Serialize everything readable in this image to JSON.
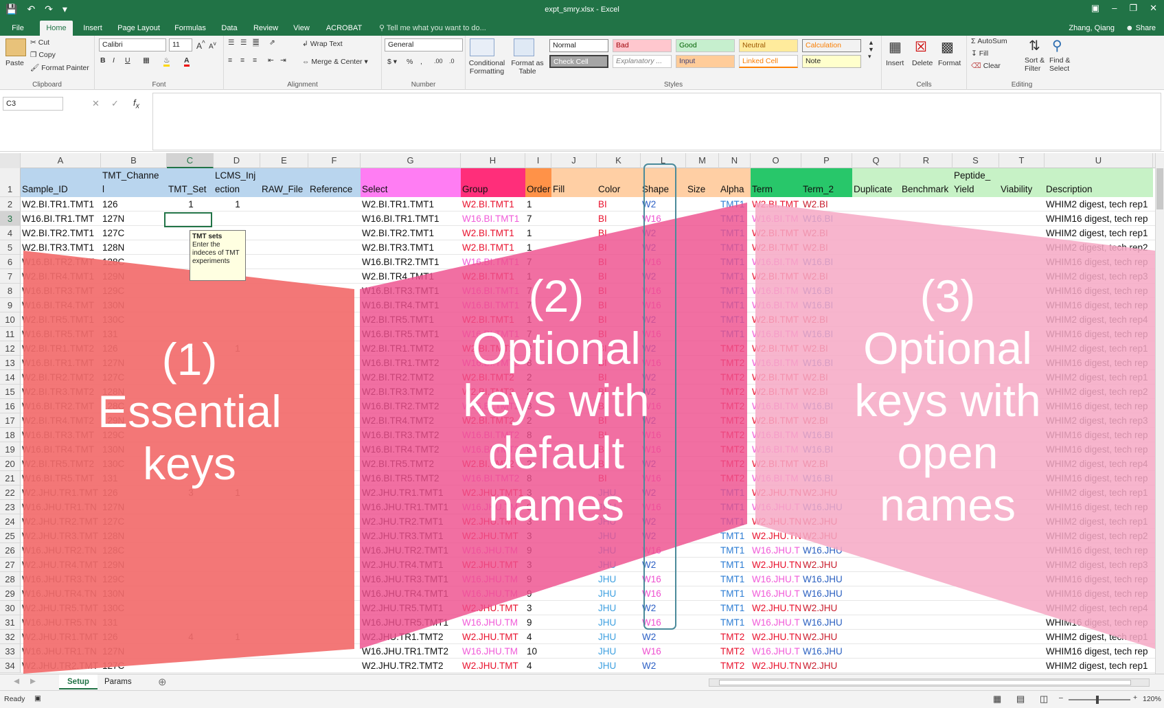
{
  "app": {
    "title": "expt_smry.xlsx - Excel",
    "user": "Zhang, Qiang",
    "share": "Share",
    "tell_me": "Tell me what you want to do..."
  },
  "tabs": [
    "File",
    "Home",
    "Insert",
    "Page Layout",
    "Formulas",
    "Data",
    "Review",
    "View",
    "ACROBAT"
  ],
  "ribbon": {
    "clipboard": {
      "label": "Clipboard",
      "paste": "Paste",
      "cut": "Cut",
      "copy": "Copy",
      "painter": "Format Painter"
    },
    "font": {
      "label": "Font",
      "name": "Calibri",
      "size": "11"
    },
    "alignment": {
      "label": "Alignment",
      "wrap": "Wrap Text",
      "merge": "Merge & Center"
    },
    "number": {
      "label": "Number",
      "format": "General"
    },
    "styles": {
      "label": "Styles",
      "cond": "Conditional Formatting",
      "table": "Format as Table",
      "normal": "Normal",
      "bad": "Bad",
      "good": "Good",
      "neutral": "Neutral",
      "calculation": "Calculation",
      "check": "Check Cell",
      "explanatory": "Explanatory ...",
      "input": "Input",
      "linked": "Linked Cell",
      "note": "Note"
    },
    "cells": {
      "label": "Cells",
      "insert": "Insert",
      "delete": "Delete",
      "format": "Format"
    },
    "editing": {
      "label": "Editing",
      "autosum": "AutoSum",
      "fill": "Fill",
      "clear": "Clear",
      "sort": "Sort & Filter",
      "find": "Find & Select"
    }
  },
  "namebox": "C3",
  "columns": [
    "A",
    "B",
    "C",
    "D",
    "E",
    "F",
    "G",
    "H",
    "I",
    "J",
    "K",
    "L",
    "M",
    "N",
    "O",
    "P",
    "Q",
    "R",
    "S",
    "T",
    "U"
  ],
  "header_top": {
    "B": "TMT_Channe",
    "D": "LCMS_Inj",
    "S": "Peptide_"
  },
  "header_bottom": {
    "A": "Sample_ID",
    "B": "l",
    "C": "TMT_Set",
    "D": "ection",
    "E": "RAW_File",
    "F": "Reference",
    "G": "Select",
    "H": "Group",
    "I": "Order",
    "J": "Fill",
    "K": "Color",
    "L": "Shape",
    "M": "Size",
    "N": "Alpha",
    "O": "Term",
    "P": "Term_2",
    "Q": "Duplicate",
    "R": "Benchmark",
    "S": "Yield",
    "T": "Viability",
    "U": "Description"
  },
  "rows": [
    {
      "n": "2",
      "A": "W2.BI.TR1.TMT1",
      "B": "126",
      "C": "1",
      "D": "1",
      "G": "W2.BI.TR1.TMT1",
      "H": "W2.BI.TMT1",
      "I": "1",
      "K": "BI",
      "L": "W2",
      "N": "TMT1",
      "O": "W2.BI.TMT",
      "P": "W2.BI",
      "U": "WHIM2 digest, tech rep1"
    },
    {
      "n": "3",
      "A": "W16.BI.TR1.TMT",
      "B": "127N",
      "G": "W16.BI.TR1.TMT1",
      "H": "W16.BI.TMT1",
      "I": "7",
      "K": "BI",
      "L": "W16",
      "N": "TMT1",
      "O": "W16.BI.TM",
      "P": "W16.BI",
      "U": "WHIM16 digest, tech rep"
    },
    {
      "n": "4",
      "A": "W2.BI.TR2.TMT1",
      "B": "127C",
      "G": "W2.BI.TR2.TMT1",
      "H": "W2.BI.TMT1",
      "I": "1",
      "K": "BI",
      "L": "W2",
      "N": "TMT1",
      "O": "W2.BI.TMT",
      "P": "W2.BI",
      "U": "WHIM2 digest, tech rep1"
    },
    {
      "n": "5",
      "A": "W2.BI.TR3.TMT1",
      "B": "128N",
      "G": "W2.BI.TR3.TMT1",
      "H": "W2.BI.TMT1",
      "I": "1",
      "K": "BI",
      "L": "W2",
      "N": "TMT1",
      "O": "W2.BI.TMT",
      "P": "W2.BI",
      "U": "WHIM2 digest, tech rep2"
    },
    {
      "n": "6",
      "A": "W16.BI.TR2.TMT",
      "B": "128C",
      "G": "W16.BI.TR2.TMT1",
      "H": "W16.BI.TMT1",
      "I": "7",
      "K": "BI",
      "L": "W16",
      "N": "TMT1",
      "O": "W16.BI.TM",
      "P": "W16.BI",
      "U": "WHIM16 digest, tech rep"
    },
    {
      "n": "7",
      "A": "W2.BI.TR4.TMT1",
      "B": "129N",
      "G": "W2.BI.TR4.TMT1",
      "H": "W2.BI.TMT1",
      "I": "1",
      "K": "BI",
      "L": "W2",
      "N": "TMT1",
      "O": "W2.BI.TMT",
      "P": "W2.BI",
      "U": "WHIM2 digest, tech rep3"
    },
    {
      "n": "8",
      "A": "W16.BI.TR3.TMT",
      "B": "129C",
      "G": "W16.BI.TR3.TMT1",
      "H": "W16.BI.TMT1",
      "I": "7",
      "K": "BI",
      "L": "W16",
      "N": "TMT1",
      "O": "W16.BI.TM",
      "P": "W16.BI",
      "U": "WHIM16 digest, tech rep"
    },
    {
      "n": "9",
      "A": "W16.BI.TR4.TMT",
      "B": "130N",
      "G": "W16.BI.TR4.TMT1",
      "H": "W16.BI.TMT1",
      "I": "7",
      "K": "BI",
      "L": "W16",
      "N": "TMT1",
      "O": "W16.BI.TM",
      "P": "W16.BI",
      "U": "WHIM16 digest, tech rep"
    },
    {
      "n": "10",
      "A": "W2.BI.TR5.TMT1",
      "B": "130C",
      "G": "W2.BI.TR5.TMT1",
      "H": "W2.BI.TMT1",
      "I": "1",
      "K": "BI",
      "L": "W2",
      "N": "TMT1",
      "O": "W2.BI.TMT",
      "P": "W2.BI",
      "U": "WHIM2 digest, tech rep4"
    },
    {
      "n": "11",
      "A": "W16.BI.TR5.TMT",
      "B": "131",
      "G": "W16.BI.TR5.TMT1",
      "H": "W16.BI.TMT1",
      "I": "7",
      "K": "BI",
      "L": "W16",
      "N": "TMT1",
      "O": "W16.BI.TM",
      "P": "W16.BI",
      "U": "WHIM16 digest, tech rep"
    },
    {
      "n": "12",
      "A": "W2.BI.TR1.TMT2",
      "B": "126",
      "C": "2",
      "D": "1",
      "G": "W2.BI.TR1.TMT2",
      "H": "W2.BI.TMT2",
      "I": "2",
      "K": "BI",
      "L": "W2",
      "N": "TMT2",
      "O": "W2.BI.TMT",
      "P": "W2.BI",
      "U": "WHIM2 digest, tech rep1"
    },
    {
      "n": "13",
      "A": "W16.BI.TR1.TMT",
      "B": "127N",
      "G": "W16.BI.TR1.TMT2",
      "H": "W16.BI.TMT2",
      "I": "8",
      "K": "BI",
      "L": "W16",
      "N": "TMT2",
      "O": "W16.BI.TM",
      "P": "W16.BI",
      "U": "WHIM16 digest, tech rep"
    },
    {
      "n": "14",
      "A": "W2.BI.TR2.TMT2",
      "B": "127C",
      "G": "W2.BI.TR2.TMT2",
      "H": "W2.BI.TMT2",
      "I": "2",
      "K": "BI",
      "L": "W2",
      "N": "TMT2",
      "O": "W2.BI.TMT",
      "P": "W2.BI",
      "U": "WHIM2 digest, tech rep1"
    },
    {
      "n": "15",
      "A": "W2.BI.TR3.TMT2",
      "B": "128N",
      "G": "W2.BI.TR3.TMT2",
      "H": "W2.BI.TMT2",
      "I": "2",
      "K": "BI",
      "L": "W2",
      "N": "TMT2",
      "O": "W2.BI.TMT",
      "P": "W2.BI",
      "U": "WHIM2 digest, tech rep2"
    },
    {
      "n": "16",
      "A": "W16.BI.TR2.TMT",
      "B": "128C",
      "G": "W16.BI.TR2.TMT2",
      "H": "W16.BI.TMT2",
      "I": "8",
      "K": "BI",
      "L": "W16",
      "N": "TMT2",
      "O": "W16.BI.TM",
      "P": "W16.BI",
      "U": "WHIM16 digest, tech rep"
    },
    {
      "n": "17",
      "A": "W2.BI.TR4.TMT2",
      "B": "129N",
      "G": "W2.BI.TR4.TMT2",
      "H": "W2.BI.TMT2",
      "I": "2",
      "K": "BI",
      "L": "W2",
      "N": "TMT2",
      "O": "W2.BI.TMT",
      "P": "W2.BI",
      "U": "WHIM2 digest, tech rep3"
    },
    {
      "n": "18",
      "A": "W16.BI.TR3.TMT",
      "B": "129C",
      "G": "W16.BI.TR3.TMT2",
      "H": "W16.BI.TMT2",
      "I": "8",
      "K": "BI",
      "L": "W16",
      "N": "TMT2",
      "O": "W16.BI.TM",
      "P": "W16.BI",
      "U": "WHIM16 digest, tech rep"
    },
    {
      "n": "19",
      "A": "W16.BI.TR4.TMT",
      "B": "130N",
      "G": "W16.BI.TR4.TMT2",
      "H": "W16.BI.TMT2",
      "I": "8",
      "K": "BI",
      "L": "W16",
      "N": "TMT2",
      "O": "W16.BI.TM",
      "P": "W16.BI",
      "U": "WHIM16 digest, tech rep"
    },
    {
      "n": "20",
      "A": "W2.BI.TR5.TMT2",
      "B": "130C",
      "G": "W2.BI.TR5.TMT2",
      "H": "W2.BI.TMT2",
      "I": "2",
      "K": "BI",
      "L": "W2",
      "N": "TMT2",
      "O": "W2.BI.TMT",
      "P": "W2.BI",
      "U": "WHIM2 digest, tech rep4"
    },
    {
      "n": "21",
      "A": "W16.BI.TR5.TMT",
      "B": "131",
      "G": "W16.BI.TR5.TMT2",
      "H": "W16.BI.TMT2",
      "I": "8",
      "K": "BI",
      "L": "W16",
      "N": "TMT2",
      "O": "W16.BI.TM",
      "P": "W16.BI",
      "U": "WHIM16 digest, tech rep"
    },
    {
      "n": "22",
      "A": "W2.JHU.TR1.TMT",
      "B": "126",
      "C": "3",
      "D": "1",
      "G": "W2.JHU.TR1.TMT1",
      "H": "W2.JHU.TMT1",
      "I": "3",
      "K": "JHU",
      "L": "W2",
      "N": "TMT1",
      "O": "W2.JHU.TN",
      "P": "W2.JHU",
      "U": "WHIM2 digest, tech rep1"
    },
    {
      "n": "23",
      "A": "W16.JHU.TR1.TN",
      "B": "127N",
      "G": "W16.JHU.TR1.TMT1",
      "H": "W16.JHU.TM",
      "I": "9",
      "K": "JHU",
      "L": "W16",
      "N": "TMT1",
      "O": "W16.JHU.T",
      "P": "W16.JHU",
      "U": "WHIM16 digest, tech rep"
    },
    {
      "n": "24",
      "A": "W2.JHU.TR2.TMT",
      "B": "127C",
      "G": "W2.JHU.TR2.TMT1",
      "H": "W2.JHU.TMT",
      "I": "3",
      "K": "JHU",
      "L": "W2",
      "N": "TMT1",
      "O": "W2.JHU.TN",
      "P": "W2.JHU",
      "U": "WHIM2 digest, tech rep1"
    },
    {
      "n": "25",
      "A": "W2.JHU.TR3.TMT",
      "B": "128N",
      "G": "W2.JHU.TR3.TMT1",
      "H": "W2.JHU.TMT",
      "I": "3",
      "K": "JHU",
      "L": "W2",
      "N": "TMT1",
      "O": "W2.JHU.TN",
      "P": "W2.JHU",
      "U": "WHIM2 digest, tech rep2"
    },
    {
      "n": "26",
      "A": "W16.JHU.TR2.TN",
      "B": "128C",
      "G": "W16.JHU.TR2.TMT1",
      "H": "W16.JHU.TM",
      "I": "9",
      "K": "JHU",
      "L": "W16",
      "N": "TMT1",
      "O": "W16.JHU.T",
      "P": "W16.JHU",
      "U": "WHIM16 digest, tech rep"
    },
    {
      "n": "27",
      "A": "W2.JHU.TR4.TMT",
      "B": "129N",
      "G": "W2.JHU.TR4.TMT1",
      "H": "W2.JHU.TMT",
      "I": "3",
      "K": "JHU",
      "L": "W2",
      "N": "TMT1",
      "O": "W2.JHU.TN",
      "P": "W2.JHU",
      "U": "WHIM2 digest, tech rep3"
    },
    {
      "n": "28",
      "A": "W16.JHU.TR3.TN",
      "B": "129C",
      "G": "W16.JHU.TR3.TMT1",
      "H": "W16.JHU.TM",
      "I": "9",
      "K": "JHU",
      "L": "W16",
      "N": "TMT1",
      "O": "W16.JHU.T",
      "P": "W16.JHU",
      "U": "WHIM16 digest, tech rep"
    },
    {
      "n": "29",
      "A": "W16.JHU.TR4.TN",
      "B": "130N",
      "G": "W16.JHU.TR4.TMT1",
      "H": "W16.JHU.TM",
      "I": "9",
      "K": "JHU",
      "L": "W16",
      "N": "TMT1",
      "O": "W16.JHU.T",
      "P": "W16.JHU",
      "U": "WHIM16 digest, tech rep"
    },
    {
      "n": "30",
      "A": "W2.JHU.TR5.TMT",
      "B": "130C",
      "G": "W2.JHU.TR5.TMT1",
      "H": "W2.JHU.TMT",
      "I": "3",
      "K": "JHU",
      "L": "W2",
      "N": "TMT1",
      "O": "W2.JHU.TN",
      "P": "W2.JHU",
      "U": "WHIM2 digest, tech rep4"
    },
    {
      "n": "31",
      "A": "W16.JHU.TR5.TN",
      "B": "131",
      "G": "W16.JHU.TR5.TMT1",
      "H": "W16.JHU.TM",
      "I": "9",
      "K": "JHU",
      "L": "W16",
      "N": "TMT1",
      "O": "W16.JHU.T",
      "P": "W16.JHU",
      "U": "WHIM16 digest, tech rep"
    },
    {
      "n": "32",
      "A": "W2.JHU.TR1.TMT",
      "B": "126",
      "C": "4",
      "D": "1",
      "G": "W2.JHU.TR1.TMT2",
      "H": "W2.JHU.TMT",
      "I": "4",
      "K": "JHU",
      "L": "W2",
      "N": "TMT2",
      "O": "W2.JHU.TN",
      "P": "W2.JHU",
      "U": "WHIM2 digest, tech rep1"
    },
    {
      "n": "33",
      "A": "W16.JHU.TR1.TN",
      "B": "127N",
      "G": "W16.JHU.TR1.TMT2",
      "H": "W16.JHU.TM",
      "I": "10",
      "K": "JHU",
      "L": "W16",
      "N": "TMT2",
      "O": "W16.JHU.T",
      "P": "W16.JHU",
      "U": "WHIM16 digest, tech rep"
    },
    {
      "n": "34",
      "A": "W2.JHU.TR2.TMT",
      "B": "127C",
      "G": "W2.JHU.TR2.TMT2",
      "H": "W2.JHU.TMT",
      "I": "4",
      "K": "JHU",
      "L": "W2",
      "N": "TMT2",
      "O": "W2.JHU.TN",
      "P": "W2.JHU",
      "U": "WHIM2 digest, tech rep1"
    }
  ],
  "comment": {
    "title": "TMT sets",
    "body": "Enter the indeces of TMT experiments"
  },
  "overlays": {
    "essential": [
      "(1)",
      "Essential",
      "keys"
    ],
    "default": [
      "(2)",
      "Optional",
      "keys with",
      "default",
      "names"
    ],
    "open": [
      "(3)",
      "Optional",
      "keys with",
      "open",
      "names"
    ]
  },
  "sheets": [
    "Setup",
    "Params"
  ],
  "status": {
    "ready": "Ready",
    "zoom": "120%"
  },
  "colors": {
    "excel_green": "#217346",
    "essential": "#f26b6b",
    "default": "#ee4f8e",
    "open": "#f6a8c4"
  }
}
